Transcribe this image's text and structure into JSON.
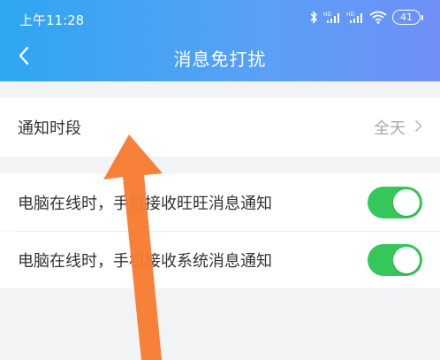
{
  "status_bar": {
    "time": "上午11:28",
    "battery": "41",
    "icons": [
      "bluetooth-icon",
      "signal-hd-icon",
      "signal-hd-icon",
      "wifi-icon",
      "battery-icon"
    ]
  },
  "header": {
    "title": "消息免打扰",
    "back_icon": "chevron-left-icon",
    "gradient_colors": [
      "#2ea6f2",
      "#6f8ff7"
    ]
  },
  "settings": {
    "notify_period": {
      "label": "通知时段",
      "value": "全天",
      "icon": "chevron-right-icon"
    },
    "toggles": [
      {
        "label": "电脑在线时，手机接收旺旺消息通知",
        "on": true
      },
      {
        "label": "电脑在线时，手机接收系统消息通知",
        "on": true
      }
    ]
  },
  "annotation": {
    "type": "arrow",
    "color": "#f77a2e",
    "icon": "arrow-up-annotation"
  },
  "colors": {
    "toggle_on": "#35c759",
    "background": "#f2f3f5"
  }
}
